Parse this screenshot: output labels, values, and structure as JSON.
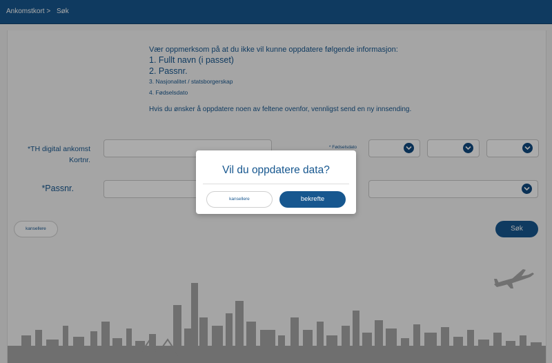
{
  "header": {
    "breadcrumb_root": "Ankomstkort >",
    "breadcrumb_current": "Søk"
  },
  "notice": {
    "lead": "Vær oppmerksom på at du ikke vil kunne oppdatere følgende informasjon:",
    "items": [
      "1. Fullt navn (i passet)",
      "2. Passnr.",
      "3. Nasjonalitet / statsborgerskap",
      "4. Fødselsdato"
    ],
    "footer": "Hvis du ønsker å oppdatere noen av feltene ovenfor, vennligst send en ny innsending."
  },
  "form": {
    "card_label_line1": "*TH digital ankomst",
    "card_label_line2": "Kortnr.",
    "birth_label": "* Fødselsdato",
    "passport_label": "*Passnr.",
    "cancel_label": "kansellere",
    "search_label": "Søk"
  },
  "modal": {
    "title": "Vil du oppdatere data?",
    "cancel_label": "kansellere",
    "confirm_label": "bekrefte"
  },
  "colors": {
    "primary": "#17578f",
    "overlay": "rgba(0,0,0,0.33)"
  },
  "icons": {
    "select": "chevron-down-icon",
    "plane": "airplane-icon"
  }
}
